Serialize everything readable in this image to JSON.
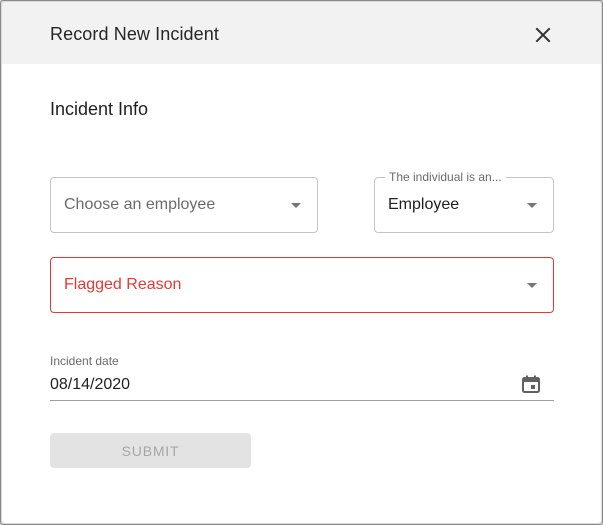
{
  "dialog": {
    "title": "Record New Incident",
    "close_icon": "close-icon"
  },
  "section": {
    "title": "Incident Info"
  },
  "employee_select": {
    "placeholder": "Choose an employee",
    "icon": "chevron-down-icon"
  },
  "individual_type_select": {
    "label": "The individual is an...",
    "value": "Employee",
    "icon": "chevron-down-icon"
  },
  "flagged_reason_select": {
    "placeholder": "Flagged Reason",
    "state": "error",
    "icon": "chevron-down-icon"
  },
  "incident_date": {
    "label": "Incident date",
    "value": "08/14/2020",
    "icon": "calendar-icon"
  },
  "submit_button": {
    "label": "SUBMIT",
    "disabled": true
  },
  "colors": {
    "header_bg": "#f2f2f2",
    "error": "#e53935",
    "disabled_bg": "#e3e3e3",
    "disabled_text": "#a6a6a6"
  }
}
